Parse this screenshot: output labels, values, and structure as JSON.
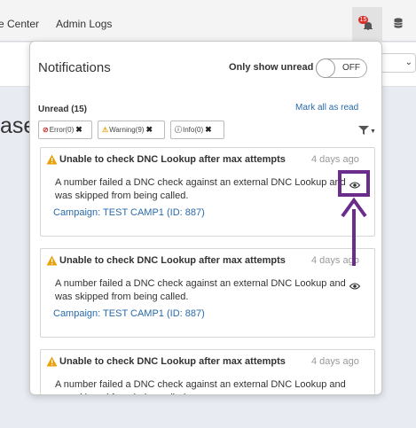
{
  "topnav": {
    "links": [
      "e Center",
      "Admin Logs"
    ],
    "notification_count": "15",
    "bell_icon": "bell-icon",
    "database_icon": "database-icon"
  },
  "background": {
    "heading_fragment": "ase"
  },
  "panel": {
    "title": "Notifications",
    "only_unread_label": "Only show unread",
    "toggle_text": "OFF",
    "unread_count": "Unread (15)",
    "mark_all_read": "Mark all as read",
    "filters": [
      {
        "icon": "error-icon",
        "glyph": "⊘",
        "label": "Error(0)",
        "color": "#c9302c"
      },
      {
        "icon": "warning-icon",
        "glyph": "⚠",
        "label": "Warning(9)",
        "color": "#e8a20c"
      },
      {
        "icon": "info-icon",
        "glyph": "ⓘ",
        "label": "Info(0)",
        "color": "#777777"
      }
    ]
  },
  "notifications": [
    {
      "title": "Unable to check DNC Lookup after max attempts",
      "time": "4 days ago",
      "body": "A number failed a DNC check against an external DNC Lookup and was skipped from being called.",
      "link": "Campaign: TEST CAMP1 (ID: 887)"
    },
    {
      "title": "Unable to check DNC Lookup after max attempts",
      "time": "4 days ago",
      "body": "A number failed a DNC check against an external DNC Lookup and was skipped from being called.",
      "link": "Campaign: TEST CAMP1 (ID: 887)"
    },
    {
      "title": "Unable to check DNC Lookup after max attempts",
      "time": "4 days ago",
      "body": "A number failed a DNC check against an external DNC Lookup and was skipped from being called.",
      "link": ""
    }
  ],
  "colors": {
    "link": "#2a6aa9",
    "warning": "#e8a20c",
    "badge": "#d9302c",
    "annotation": "#6b2d8c"
  }
}
